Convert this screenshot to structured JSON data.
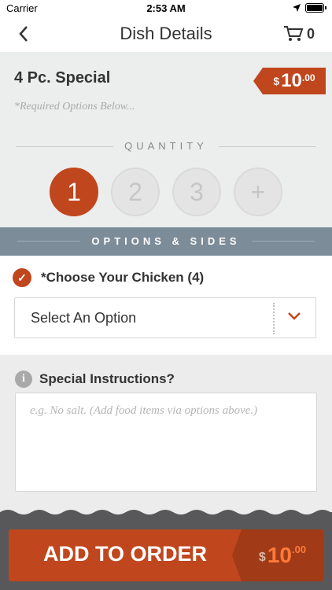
{
  "status": {
    "carrier": "Carrier",
    "time": "2:53 AM"
  },
  "nav": {
    "title": "Dish Details",
    "cart_count": "0"
  },
  "dish": {
    "name": "4 Pc. Special",
    "required_note": "*Required Options Below...",
    "price": {
      "currency": "$",
      "amount": "10",
      "cents": ".00"
    }
  },
  "quantity": {
    "label": "QUANTITY",
    "options": [
      "1",
      "2",
      "3",
      "+"
    ],
    "selected": "1"
  },
  "options": {
    "header": "OPTIONS & SIDES",
    "choose_label": "*Choose Your Chicken (4)",
    "select_value": "Select An Option"
  },
  "special": {
    "label": "Special Instructions?",
    "placeholder": "e.g. No salt. (Add food items via options above.)"
  },
  "footer": {
    "add_label": "ADD TO ORDER",
    "price": {
      "currency": "$",
      "amount": "10",
      "cents": ".00"
    }
  },
  "colors": {
    "accent": "#c0461e",
    "header_bar": "#7c8c98",
    "footer": "#58585a"
  }
}
